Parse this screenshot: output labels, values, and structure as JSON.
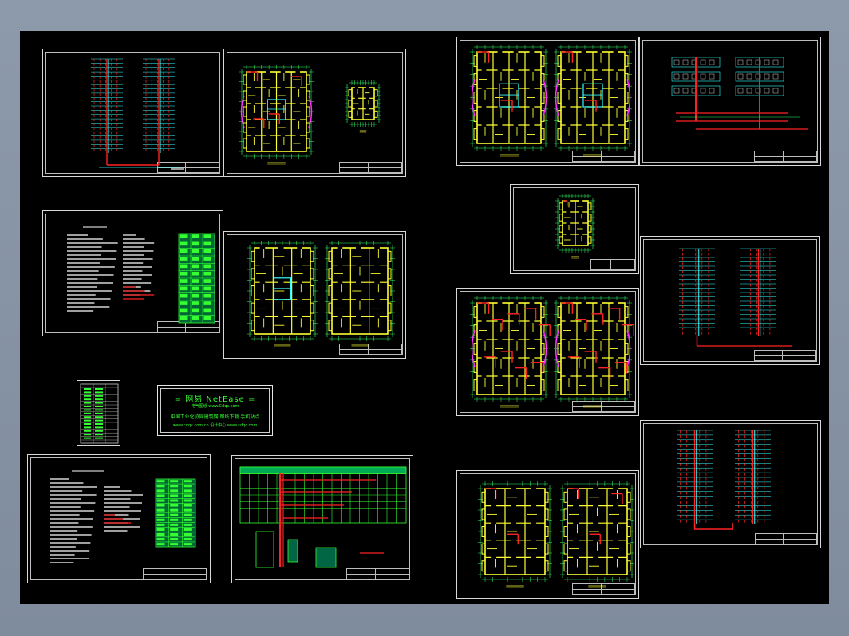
{
  "viewport": {
    "background": "#000000",
    "frame": "#8a97a8"
  },
  "colors": {
    "wall": "#ffff33",
    "pipe": "#ff2222",
    "dim": "#33ff66",
    "accent": "#ff33ff",
    "cyan": "#33ffff",
    "text": "#33ff33"
  },
  "watermark": {
    "title": "= 网易 NetEase =",
    "line1": "电气图纸      www.Cdqc.com",
    "line2": "中国工业化协同建筑网  图纸下载  手机站点",
    "line3": "www.cdqc.com.cn   设计中心  www.cdqc.com"
  },
  "sheets": [
    {
      "id": "sheet-riser-1",
      "type": "riser"
    },
    {
      "id": "sheet-plan-1",
      "type": "plan"
    },
    {
      "id": "sheet-notes-1",
      "type": "notes"
    },
    {
      "id": "sheet-plan-2",
      "type": "plan"
    },
    {
      "id": "sheet-legend-small",
      "type": "table"
    },
    {
      "id": "sheet-notes-2",
      "type": "notes"
    },
    {
      "id": "sheet-system",
      "type": "system"
    },
    {
      "id": "sheet-plan-3",
      "type": "plan"
    },
    {
      "id": "sheet-axon-1",
      "type": "axon"
    },
    {
      "id": "sheet-plan-small",
      "type": "plan"
    },
    {
      "id": "sheet-riser-2",
      "type": "riser"
    },
    {
      "id": "sheet-plan-4",
      "type": "plan"
    },
    {
      "id": "sheet-riser-3",
      "type": "riser"
    },
    {
      "id": "sheet-plan-5",
      "type": "plan"
    }
  ]
}
